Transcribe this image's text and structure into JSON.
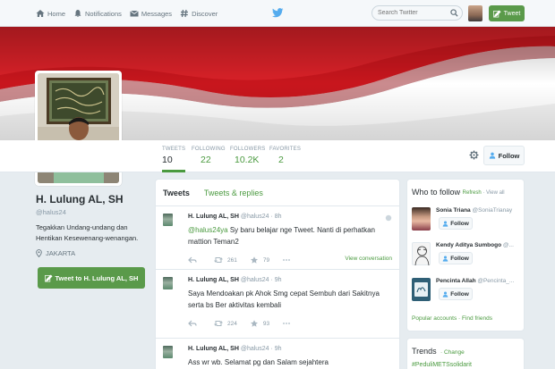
{
  "nav": {
    "home": "Home",
    "notifications": "Notifications",
    "messages": "Messages",
    "discover": "Discover",
    "search_placeholder": "Search Twitter",
    "tweet_button": "Tweet"
  },
  "profile": {
    "name": "H. Lulung AL, SH",
    "handle": "@halus24",
    "bio": "Tegakkan Undang-undang dan Hentikan Kesewenang-wenangan.",
    "location": "JAKARTA",
    "tweet_to": "Tweet to H. Lulung AL, SH"
  },
  "stats": {
    "tweets_label": "TWEETS",
    "tweets": "10",
    "following_label": "FOLLOWING",
    "following": "22",
    "followers_label": "FOLLOWERS",
    "followers": "10.2K",
    "favorites_label": "FAVORITES",
    "favorites": "2",
    "follow_button": "Follow"
  },
  "timeline": {
    "tab_tweets": "Tweets",
    "tab_replies": "Tweets & replies",
    "tweets": [
      {
        "name": "H. Lulung AL, SH",
        "handle": "@halus24",
        "time": "· 8h",
        "mention": "@halus24ya",
        "text": " Sy baru belajar nge Tweet. Nanti di perhatkan mattion Teman2",
        "retweets": "261",
        "favorites": "79",
        "view_conversation": "View conversation"
      },
      {
        "name": "H. Lulung AL, SH",
        "handle": "@halus24",
        "time": "· 9h",
        "text": "Saya Mendoakan pk Ahok Smg cepat Sembuh dari Sakitnya serta bs Ber aktivitas kembali",
        "retweets": "224",
        "favorites": "93"
      },
      {
        "name": "H. Lulung AL, SH",
        "handle": "@halus24",
        "time": "· 9h",
        "text": "Ass wr wb. Selamat pg dan Salam sejahtera"
      }
    ]
  },
  "who_to_follow": {
    "title": "Who to follow",
    "refresh": "Refresh",
    "view_all": "View all",
    "suggestions": [
      {
        "name": "Sonia Triana",
        "handle": "@SoniaTrianay",
        "follow": "Follow"
      },
      {
        "name": "Kendy Aditya Sumbogo",
        "handle": "@...",
        "follow": "Follow"
      },
      {
        "name": "Pencinta Allah",
        "handle": "@Pencinta_...",
        "follow": "Follow"
      }
    ],
    "popular_accounts": "Popular accounts",
    "find_friends": "Find friends"
  },
  "trends": {
    "title": "Trends",
    "change": "Change",
    "first": "#PeduliMETSsolidarit"
  },
  "colors": {
    "accent_green": "#4a9a3f",
    "button_green": "#5a9a4a",
    "flag_red": "#c8161d"
  }
}
